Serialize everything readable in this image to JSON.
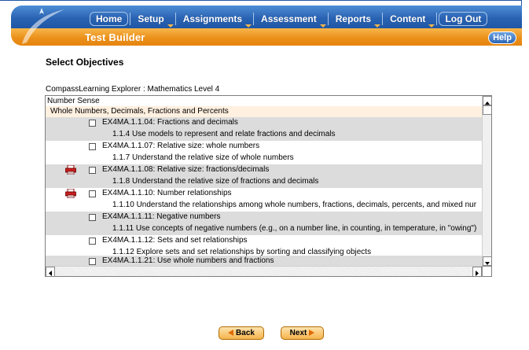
{
  "header": {
    "nav": [
      {
        "label": "Home",
        "has_caret": false
      },
      {
        "label": "Setup",
        "has_caret": true
      },
      {
        "label": "Assignments",
        "has_caret": true
      },
      {
        "label": "Assessment",
        "has_caret": true
      },
      {
        "label": "Reports",
        "has_caret": true
      },
      {
        "label": "Content",
        "has_caret": true
      },
      {
        "label": "Log Out",
        "has_caret": false
      }
    ],
    "page_heading": "Test Builder",
    "help_label": "Help"
  },
  "main": {
    "section_title": "Select Objectives",
    "breadcrumb": "CompassLearning Explorer : Mathematics Level 4",
    "strand": "Number Sense",
    "substrand": "Whole Numbers, Decimals, Fractions and Percents",
    "objectives": [
      {
        "code": "EX4MA.1.1.04: Fractions and decimals",
        "description": "1.1.4 Use models to represent and relate fractions and decimals",
        "printable": false,
        "checked": false
      },
      {
        "code": "EX4MA.1.1.07: Relative size: whole numbers",
        "description": "1.1.7 Understand the relative size of whole numbers",
        "printable": false,
        "checked": false
      },
      {
        "code": "EX4MA.1.1.08: Relative size: fractions/decimals",
        "description": "1.1.8 Understand the relative size of fractions and decimals",
        "printable": true,
        "checked": false
      },
      {
        "code": "EX4MA.1.1.10: Number relationships",
        "description": "1.1.10 Understand the relationships among whole numbers, fractions, decimals, percents, and mixed nur",
        "printable": true,
        "checked": false
      },
      {
        "code": "EX4MA.1.1.11: Negative numbers",
        "description": "1.1.11 Use concepts of negative numbers (e.g., on a number line, in counting, in temperature, in \"owing\")",
        "printable": false,
        "checked": false
      },
      {
        "code": "EX4MA.1.1.12: Sets and set relationships",
        "description": "1.1.12 Explore sets and set relationships by sorting and classifying objects",
        "printable": false,
        "checked": false
      },
      {
        "code": "EX4MA.1.1.21: Use whole numbers and fractions",
        "description": "",
        "printable": false,
        "checked": false
      }
    ]
  },
  "footer": {
    "back_label": "Back",
    "next_label": "Next"
  },
  "colors": {
    "nav_blue": "#2a63b3",
    "title_orange": "#ea8e18",
    "row_alt": "#dcdcdc",
    "substrand_bg": "#fff0e0"
  }
}
